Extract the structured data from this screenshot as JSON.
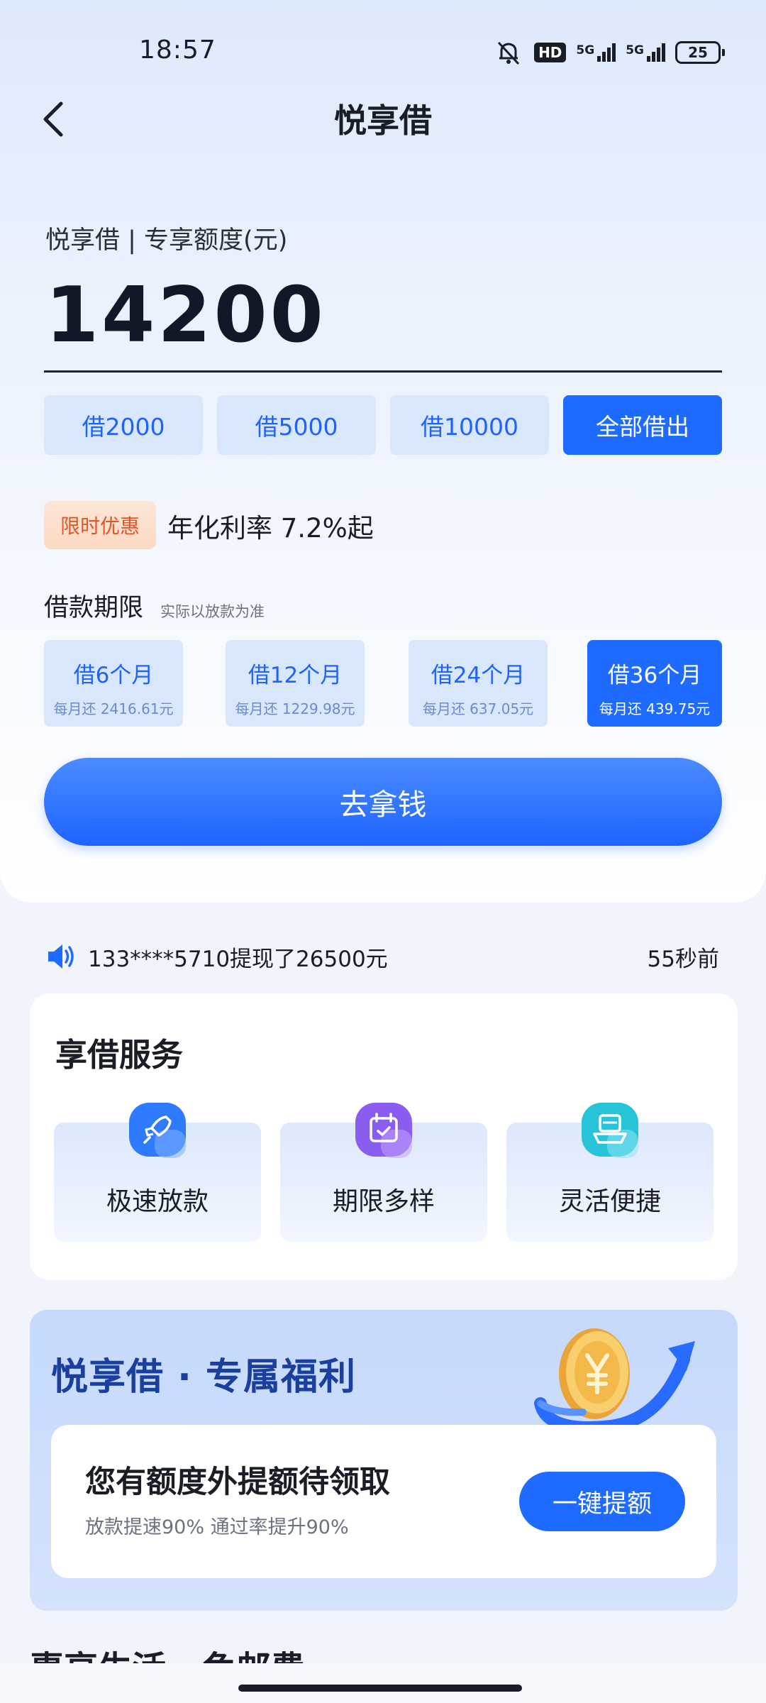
{
  "status_bar": {
    "time": "18:57",
    "hd": "HD",
    "net1": "5G",
    "net2": "5G",
    "battery": "25"
  },
  "nav": {
    "title": "悦享借",
    "back_icon": "chevron-left-icon"
  },
  "loan": {
    "quota_label": "悦享借 | 专享额度(元)",
    "amount": "14200",
    "quick_options": [
      "借2000",
      "借5000",
      "借10000",
      "全部借出"
    ],
    "selected_quick": 3,
    "promo_tag": "限时优惠",
    "promo_text": "年化利率 7.2%起",
    "term_title": "借款期限",
    "term_note": "实际以放款为准",
    "terms": [
      {
        "label": "借6个月",
        "monthly": "每月还 2416.61元"
      },
      {
        "label": "借12个月",
        "monthly": "每月还 1229.98元"
      },
      {
        "label": "借24个月",
        "monthly": "每月还 637.05元"
      },
      {
        "label": "借36个月",
        "monthly": "每月还 439.75元"
      }
    ],
    "selected_term": 3,
    "cta": "去拿钱"
  },
  "notice": {
    "icon": "speaker-icon",
    "text": "133****5710提现了26500元",
    "time": "55秒前"
  },
  "services": {
    "title": "享借服务",
    "items": [
      {
        "label": "极速放款",
        "icon": "rocket-icon",
        "color": "#2f7bff"
      },
      {
        "label": "期限多样",
        "icon": "calendar-icon",
        "color": "#8a5cf0"
      },
      {
        "label": "灵活便捷",
        "icon": "hand-icon",
        "color": "#27c4d9"
      }
    ]
  },
  "benefit": {
    "title": "悦享借 · 专属福利",
    "main": "您有额度外提额待领取",
    "sub": "放款提速90% 通过率提升90%",
    "button": "一键提额"
  },
  "next_section_title": "惠享生活 · 免邮费",
  "colors": {
    "primary": "#1f6bff",
    "promo": "#e0562b",
    "chip_bg": "#d9e7fc"
  }
}
